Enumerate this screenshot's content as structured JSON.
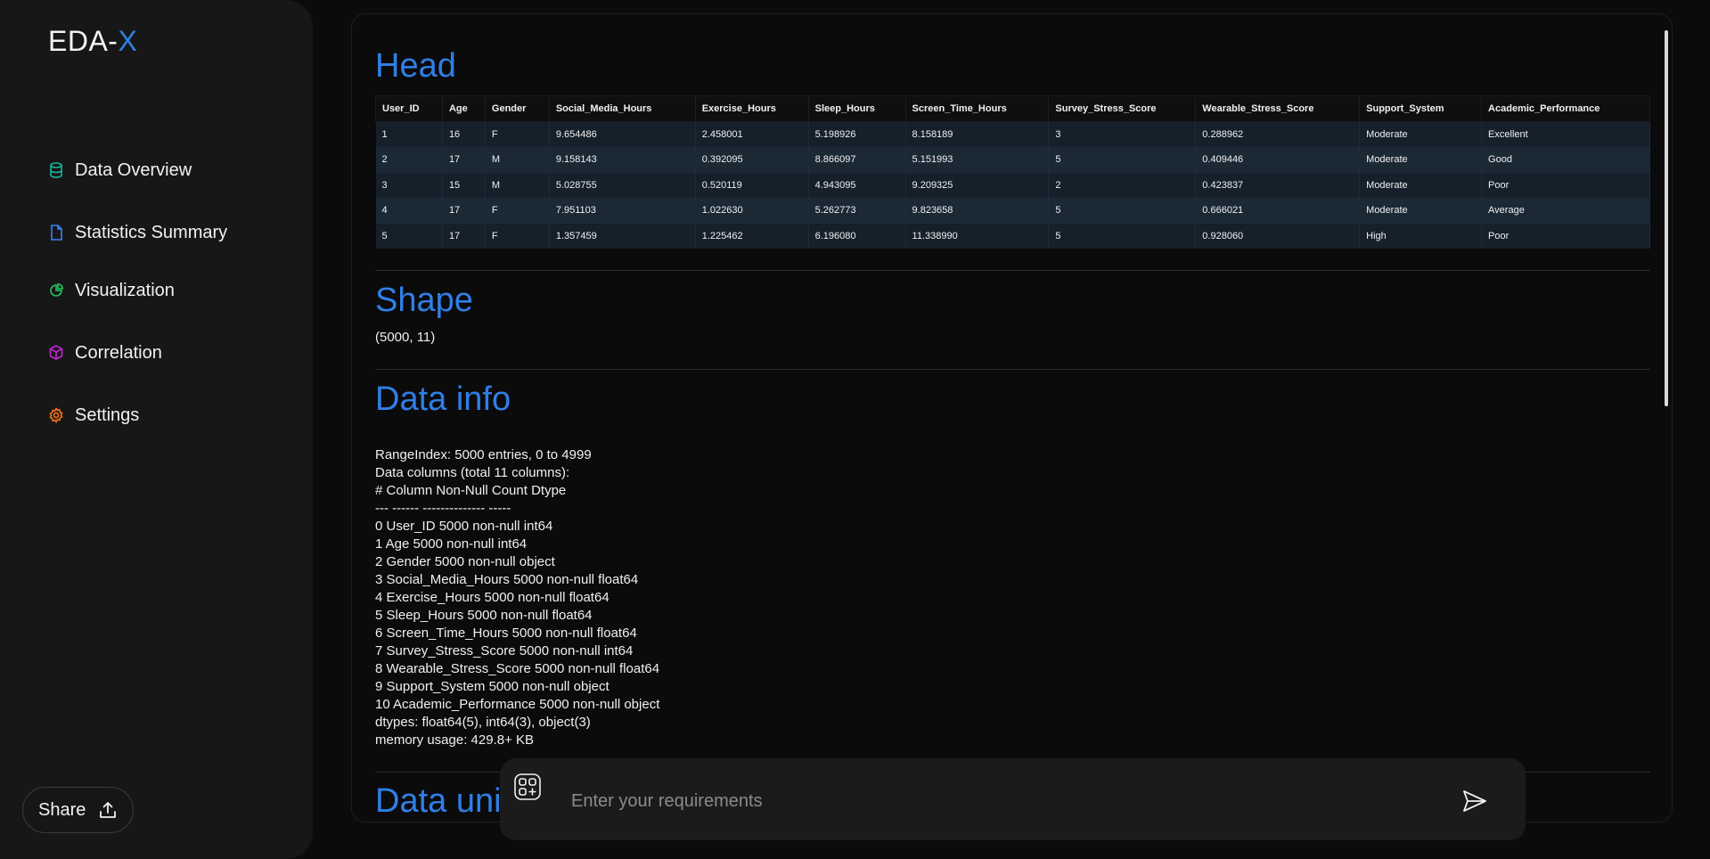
{
  "app": {
    "logo_main": "EDA-",
    "logo_accent": "X"
  },
  "sidebar": {
    "items": [
      {
        "label": "Data Overview",
        "icon": "database-icon"
      },
      {
        "label": "Statistics Summary",
        "icon": "file-icon"
      },
      {
        "label": "Visualization",
        "icon": "pie-chart-icon"
      },
      {
        "label": "Correlation",
        "icon": "cube-icon"
      },
      {
        "label": "Settings",
        "icon": "gear-icon"
      }
    ],
    "share_label": "Share"
  },
  "colors": {
    "accent": "#2f7fe6",
    "db_icon": "#19b7a3",
    "file_icon": "#3b82f6",
    "pie_icon": "#22c55e",
    "cube_icon": "#c026d3",
    "gear_icon": "#f97316"
  },
  "sections": {
    "head": {
      "title": "Head",
      "columns": [
        "User_ID",
        "Age",
        "Gender",
        "Social_Media_Hours",
        "Exercise_Hours",
        "Sleep_Hours",
        "Screen_Time_Hours",
        "Survey_Stress_Score",
        "Wearable_Stress_Score",
        "Support_System",
        "Academic_Performance"
      ],
      "rows": [
        [
          "1",
          "16",
          "F",
          "9.654486",
          "2.458001",
          "5.198926",
          "8.158189",
          "3",
          "0.288962",
          "Moderate",
          "Excellent"
        ],
        [
          "2",
          "17",
          "M",
          "9.158143",
          "0.392095",
          "8.866097",
          "5.151993",
          "5",
          "0.409446",
          "Moderate",
          "Good"
        ],
        [
          "3",
          "15",
          "M",
          "5.028755",
          "0.520119",
          "4.943095",
          "9.209325",
          "2",
          "0.423837",
          "Moderate",
          "Poor"
        ],
        [
          "4",
          "17",
          "F",
          "7.951103",
          "1.022630",
          "5.262773",
          "9.823658",
          "5",
          "0.666021",
          "Moderate",
          "Average"
        ],
        [
          "5",
          "17",
          "F",
          "1.357459",
          "1.225462",
          "6.196080",
          "11.338990",
          "5",
          "0.928060",
          "High",
          "Poor"
        ]
      ]
    },
    "shape": {
      "title": "Shape",
      "value": "(5000, 11)"
    },
    "info": {
      "title": "Data info",
      "lines": [
        "RangeIndex: 5000 entries, 0 to 4999",
        "Data columns (total 11 columns):",
        "# Column Non-Null Count Dtype",
        "--- ------ -------------- -----",
        "0 User_ID 5000 non-null int64",
        "1 Age 5000 non-null int64",
        "2 Gender 5000 non-null object",
        "3 Social_Media_Hours 5000 non-null float64",
        "4 Exercise_Hours 5000 non-null float64",
        "5 Sleep_Hours 5000 non-null float64",
        "6 Screen_Time_Hours 5000 non-null float64",
        "7 Survey_Stress_Score 5000 non-null int64",
        "8 Wearable_Stress_Score 5000 non-null float64",
        "9 Support_System 5000 non-null object",
        "10 Academic_Performance 5000 non-null object",
        "dtypes: float64(5), int64(3), object(3)",
        "memory usage: 429.8+ KB"
      ]
    },
    "unique": {
      "title": "Data unique"
    }
  },
  "prompt": {
    "placeholder": "Enter your requirements"
  }
}
